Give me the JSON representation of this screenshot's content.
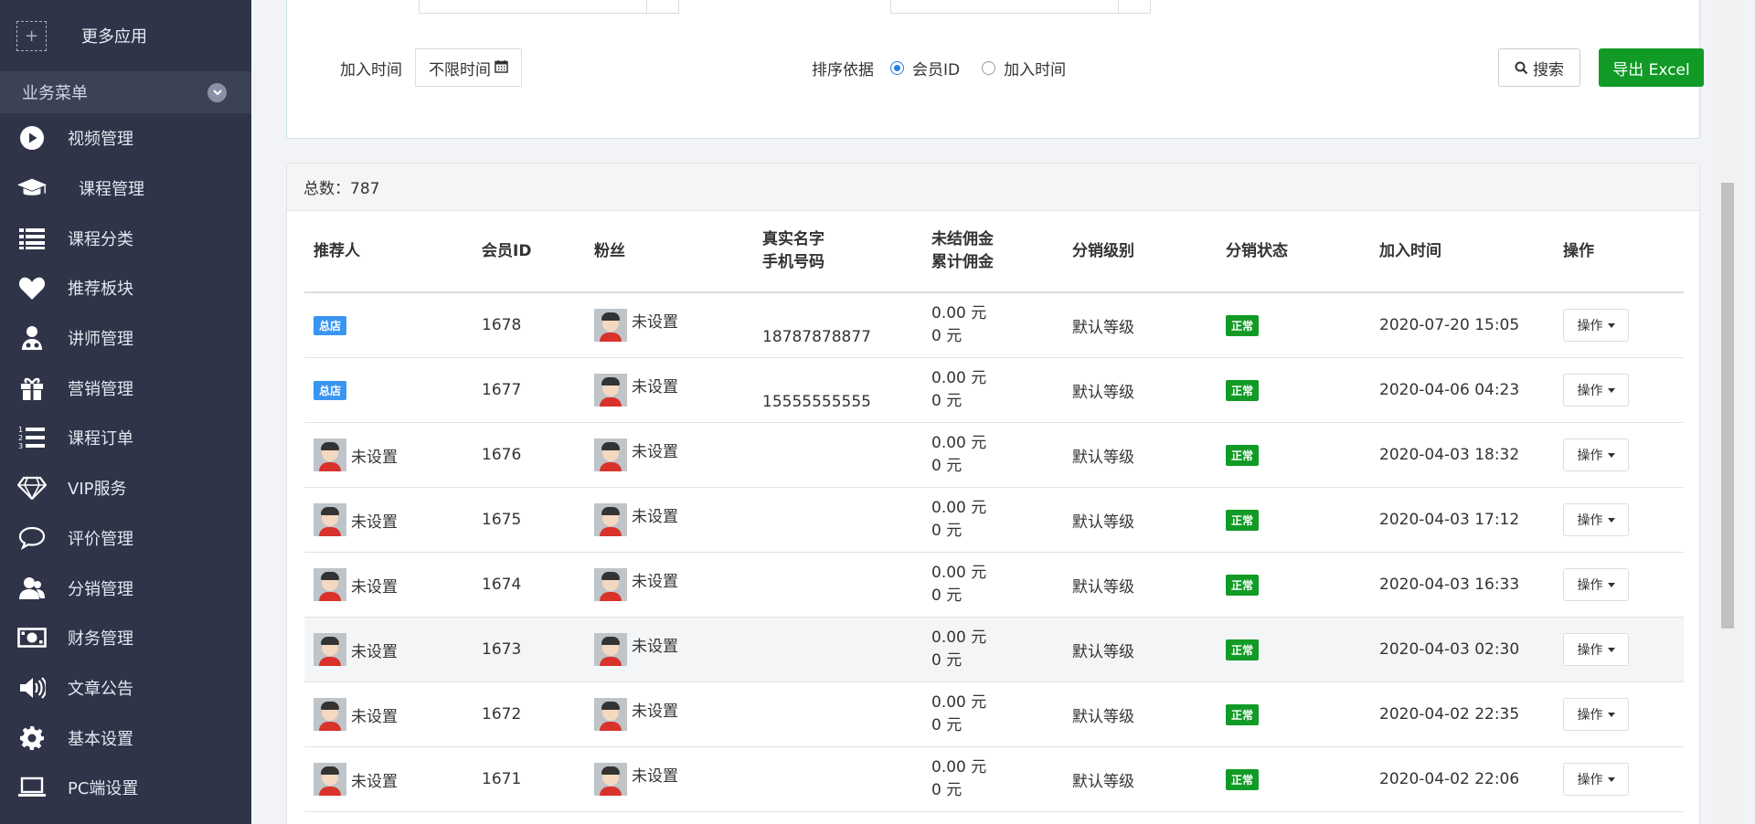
{
  "sidebar": {
    "more_apps": "更多应用",
    "menu_header": "业务菜单",
    "items": [
      {
        "label": "视频管理",
        "icon": "play-icon"
      },
      {
        "label": "课程管理",
        "icon": "graduation-cap-icon"
      },
      {
        "label": "课程分类",
        "icon": "list-icon"
      },
      {
        "label": "推荐板块",
        "icon": "heart-icon"
      },
      {
        "label": "讲师管理",
        "icon": "teacher-icon"
      },
      {
        "label": "营销管理",
        "icon": "gift-icon"
      },
      {
        "label": "课程订单",
        "icon": "ordered-list-icon"
      },
      {
        "label": "VIP服务",
        "icon": "diamond-icon"
      },
      {
        "label": "评价管理",
        "icon": "comment-icon"
      },
      {
        "label": "分销管理",
        "icon": "users-icon"
      },
      {
        "label": "财务管理",
        "icon": "money-icon"
      },
      {
        "label": "文章公告",
        "icon": "volume-icon"
      },
      {
        "label": "基本设置",
        "icon": "gear-icon"
      },
      {
        "label": "PC端设置",
        "icon": "laptop-icon"
      }
    ]
  },
  "filters": {
    "join_time_label": "加入时间",
    "join_time_value": "不限时间",
    "sort_label": "排序依据",
    "sort_options": [
      "会员ID",
      "加入时间"
    ],
    "sort_selected": "会员ID",
    "search_button": "搜索",
    "export_button": "导出 Excel"
  },
  "summary": {
    "total_label": "总数：787"
  },
  "table": {
    "headers": {
      "referrer": "推荐人",
      "member_id": "会员ID",
      "fans": "粉丝",
      "real_name": "真实名字",
      "phone": "手机号码",
      "unsettled": "未结佣金",
      "total_commission": "累计佣金",
      "level": "分销级别",
      "status": "分销状态",
      "join_time": "加入时间",
      "action": "操作"
    },
    "rows": [
      {
        "referrer": "总店",
        "referrer_type": "badge",
        "id": "1678",
        "fan": "未设置",
        "phone": "18787878877",
        "unsettled": "0.00 元",
        "total": "0 元",
        "level": "默认等级",
        "status": "正常",
        "time": "2020-07-20 15:05",
        "action": "操作"
      },
      {
        "referrer": "总店",
        "referrer_type": "badge",
        "id": "1677",
        "fan": "未设置",
        "phone": "15555555555",
        "unsettled": "0.00 元",
        "total": "0 元",
        "level": "默认等级",
        "status": "正常",
        "time": "2020-04-06 04:23",
        "action": "操作"
      },
      {
        "referrer": "未设置",
        "referrer_type": "user",
        "id": "1676",
        "fan": "未设置",
        "phone": "",
        "unsettled": "0.00 元",
        "total": "0 元",
        "level": "默认等级",
        "status": "正常",
        "time": "2020-04-03 18:32",
        "action": "操作"
      },
      {
        "referrer": "未设置",
        "referrer_type": "user",
        "id": "1675",
        "fan": "未设置",
        "phone": "",
        "unsettled": "0.00 元",
        "total": "0 元",
        "level": "默认等级",
        "status": "正常",
        "time": "2020-04-03 17:12",
        "action": "操作"
      },
      {
        "referrer": "未设置",
        "referrer_type": "user",
        "id": "1674",
        "fan": "未设置",
        "phone": "",
        "unsettled": "0.00 元",
        "total": "0 元",
        "level": "默认等级",
        "status": "正常",
        "time": "2020-04-03 16:33",
        "action": "操作"
      },
      {
        "referrer": "未设置",
        "referrer_type": "user",
        "id": "1673",
        "fan": "未设置",
        "phone": "",
        "unsettled": "0.00 元",
        "total": "0 元",
        "level": "默认等级",
        "status": "正常",
        "time": "2020-04-03 02:30",
        "action": "操作"
      },
      {
        "referrer": "未设置",
        "referrer_type": "user",
        "id": "1672",
        "fan": "未设置",
        "phone": "",
        "unsettled": "0.00 元",
        "total": "0 元",
        "level": "默认等级",
        "status": "正常",
        "time": "2020-04-02 22:35",
        "action": "操作"
      },
      {
        "referrer": "未设置",
        "referrer_type": "user",
        "id": "1671",
        "fan": "未设置",
        "phone": "",
        "unsettled": "0.00 元",
        "total": "0 元",
        "level": "默认等级",
        "status": "正常",
        "time": "2020-04-02 22:06",
        "action": "操作"
      }
    ]
  },
  "colors": {
    "sidebar_bg": "#2f3448",
    "accent_green": "#119b26",
    "badge_blue": "#3a95f2",
    "radio_blue": "#2a7de1"
  }
}
